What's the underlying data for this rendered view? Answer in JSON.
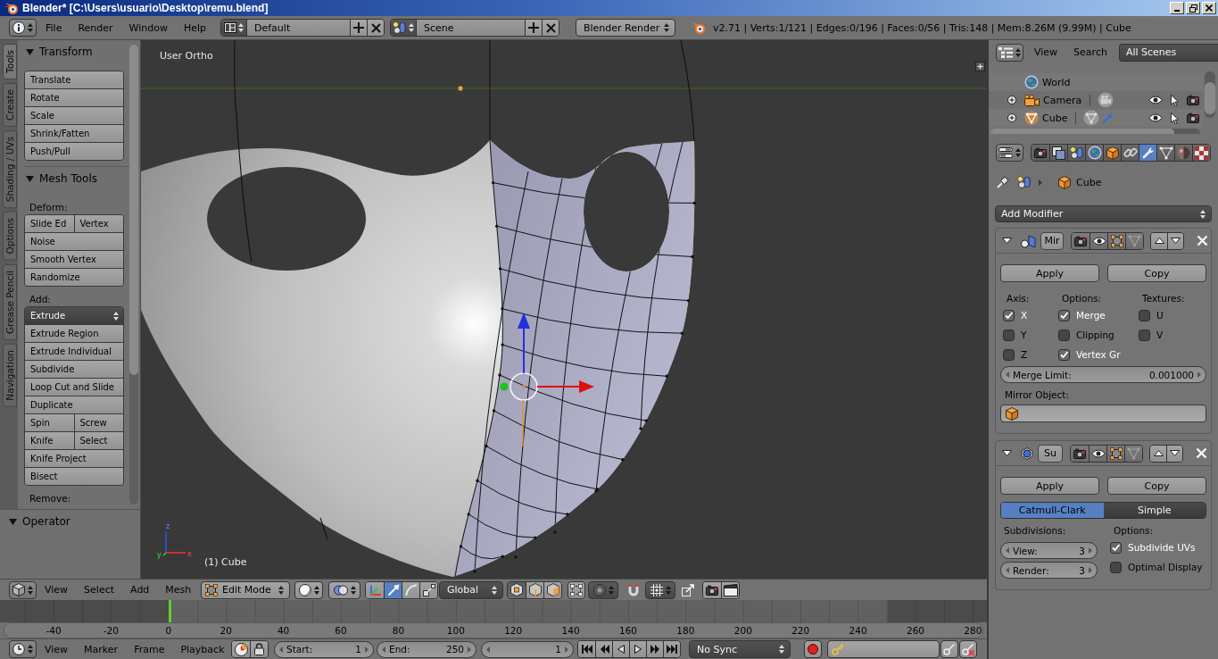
{
  "window": {
    "title": "Blender* [C:\\Users\\usuario\\Desktop\\remu.blend]"
  },
  "info_header": {
    "menus": [
      "File",
      "Render",
      "Window",
      "Help"
    ],
    "layout": "Default",
    "scene": "Scene",
    "engine": "Blender Render",
    "stats": "v2.71 | Verts:1/121 | Edges:0/196 | Faces:0/56 | Tris:148 | Mem:8.26M (9.99M) | Cube"
  },
  "tool_shelf": {
    "tabs": [
      {
        "label": "Tools",
        "selected": true
      },
      {
        "label": "Create",
        "selected": false
      },
      {
        "label": "Shading / UVs",
        "selected": false
      },
      {
        "label": "Options",
        "selected": false
      },
      {
        "label": "Grease Pencil",
        "selected": false
      },
      {
        "label": "Navigation",
        "selected": false
      }
    ],
    "panels": [
      {
        "title": "Transform",
        "expanded": true,
        "sections": [
          {
            "rows": [
              [
                {
                  "label": "Translate",
                  "kind": "button"
                }
              ],
              [
                {
                  "label": "Rotate",
                  "kind": "button"
                }
              ],
              [
                {
                  "label": "Scale",
                  "kind": "button"
                }
              ],
              [
                {
                  "label": "Shrink/Fatten",
                  "kind": "button"
                }
              ],
              [
                {
                  "label": "Push/Pull",
                  "kind": "button"
                }
              ]
            ]
          }
        ]
      },
      {
        "title": "Mesh Tools",
        "expanded": true,
        "sections": [
          {
            "label": "Deform:",
            "rows": [
              [
                {
                  "label": "Slide Ed",
                  "kind": "button"
                },
                {
                  "label": "Vertex",
                  "kind": "button"
                }
              ],
              [
                {
                  "label": "Noise",
                  "kind": "button"
                }
              ],
              [
                {
                  "label": "Smooth Vertex",
                  "kind": "button"
                }
              ],
              [
                {
                  "label": "Randomize",
                  "kind": "button"
                }
              ]
            ]
          },
          {
            "label": "Add:",
            "rows": [
              [
                {
                  "label": "Extrude",
                  "kind": "dropdown"
                }
              ],
              [
                {
                  "label": "Extrude Region",
                  "kind": "button"
                }
              ],
              [
                {
                  "label": "Extrude Individual",
                  "kind": "button"
                }
              ],
              [
                {
                  "label": "Subdivide",
                  "kind": "button"
                }
              ],
              [
                {
                  "label": "Loop Cut and Slide",
                  "kind": "button"
                }
              ],
              [
                {
                  "label": "Duplicate",
                  "kind": "button"
                }
              ],
              [
                {
                  "label": "Spin",
                  "kind": "button"
                },
                {
                  "label": "Screw",
                  "kind": "button"
                }
              ],
              [
                {
                  "label": "Knife",
                  "kind": "button"
                },
                {
                  "label": "Select",
                  "kind": "button"
                }
              ],
              [
                {
                  "label": "Knife Project",
                  "kind": "button"
                }
              ],
              [
                {
                  "label": "Bisect",
                  "kind": "button"
                }
              ]
            ]
          },
          {
            "label": "Remove:"
          }
        ]
      }
    ],
    "operator": {
      "title": "Operator",
      "expanded": true
    }
  },
  "viewport": {
    "view_name": "User Ortho",
    "object_info": "(1) Cube",
    "axis_labels": [
      "z",
      "y",
      "x"
    ]
  },
  "view3d_header": {
    "menus": [
      "View",
      "Select",
      "Add",
      "Mesh"
    ],
    "mode": "Edit Mode",
    "manipulators": [
      {
        "kind": "translate",
        "selected": true
      },
      {
        "kind": "rotate",
        "selected": false
      },
      {
        "kind": "scale",
        "selected": false
      }
    ],
    "orientation": "Global",
    "select_modes": [
      {
        "kind": "vertex",
        "selected": true
      },
      {
        "kind": "edge",
        "selected": false
      },
      {
        "kind": "face",
        "selected": false
      }
    ]
  },
  "timeline": {
    "ticks": [
      "-40",
      "-20",
      "0",
      "20",
      "40",
      "60",
      "80",
      "100",
      "120",
      "140",
      "160",
      "180",
      "200",
      "220",
      "240",
      "260",
      "280"
    ],
    "menus": [
      "View",
      "Marker",
      "Frame",
      "Playback"
    ],
    "start": {
      "label": "Start:",
      "value": "1"
    },
    "end": {
      "label": "End:",
      "value": "250"
    },
    "current_frame": "1",
    "sync": "No Sync"
  },
  "outliner": {
    "menus": [
      "View",
      "Search"
    ],
    "display": "All Scenes",
    "items": [
      {
        "name": "World",
        "kind": "world"
      },
      {
        "name": "Camera",
        "kind": "camera",
        "expanded": false
      },
      {
        "name": "Cube",
        "kind": "mesh",
        "expanded": false
      }
    ]
  },
  "properties": {
    "tabs": [
      {
        "kind": "render",
        "selected": false
      },
      {
        "kind": "render_layers",
        "selected": false
      },
      {
        "kind": "scene",
        "selected": false
      },
      {
        "kind": "world",
        "selected": false
      },
      {
        "kind": "object",
        "selected": false
      },
      {
        "kind": "constraints",
        "selected": false
      },
      {
        "kind": "modifiers",
        "selected": true
      },
      {
        "kind": "data",
        "selected": false
      },
      {
        "kind": "material",
        "selected": false
      },
      {
        "kind": "texture",
        "selected": false
      }
    ],
    "context": "Cube",
    "add_modifier": "Add Modifier",
    "modifiers": [
      {
        "kind": "mirror",
        "name": "Mir",
        "expanded": true,
        "toggles": [
          {
            "kind": "render",
            "on": true
          },
          {
            "kind": "viewport",
            "on": true
          },
          {
            "kind": "editmode",
            "on": true
          },
          {
            "kind": "cage",
            "on": false
          }
        ],
        "actions": [
          "Apply",
          "Copy"
        ],
        "columns": [
          {
            "heading": "Axis:",
            "options": [
              {
                "label": "X",
                "checked": true
              },
              {
                "label": "Y",
                "checked": false
              },
              {
                "label": "Z",
                "checked": false
              }
            ]
          },
          {
            "heading": "Options:",
            "options": [
              {
                "label": "Merge",
                "checked": true
              },
              {
                "label": "Clipping",
                "checked": false
              },
              {
                "label": "Vertex Gr",
                "checked": true
              }
            ]
          },
          {
            "heading": "Textures:",
            "options": [
              {
                "label": "U",
                "checked": false
              },
              {
                "label": "V",
                "checked": false
              }
            ]
          }
        ],
        "merge_limit": {
          "label": "Merge Limit:",
          "value": "0.001000"
        },
        "mirror_object": {
          "label": "Mirror Object:"
        }
      },
      {
        "kind": "subsurf",
        "name": "Su",
        "expanded": true,
        "toggles": [
          {
            "kind": "render",
            "on": true
          },
          {
            "kind": "viewport",
            "on": true
          },
          {
            "kind": "editmode",
            "on": true
          },
          {
            "kind": "cage",
            "on": false
          }
        ],
        "actions": [
          "Apply",
          "Copy"
        ],
        "algorithms": [
          {
            "label": "Catmull-Clark",
            "selected": true
          },
          {
            "label": "Simple",
            "selected": false
          }
        ],
        "subdivisions": {
          "heading": "Subdivisions:",
          "fields": [
            {
              "label": "View:",
              "value": "3"
            },
            {
              "label": "Render:",
              "value": "3"
            }
          ]
        },
        "options": {
          "heading": "Options:",
          "items": [
            {
              "label": "Subdivide UVs",
              "checked": true
            },
            {
              "label": "Optimal Display",
              "checked": false
            }
          ]
        }
      }
    ]
  }
}
